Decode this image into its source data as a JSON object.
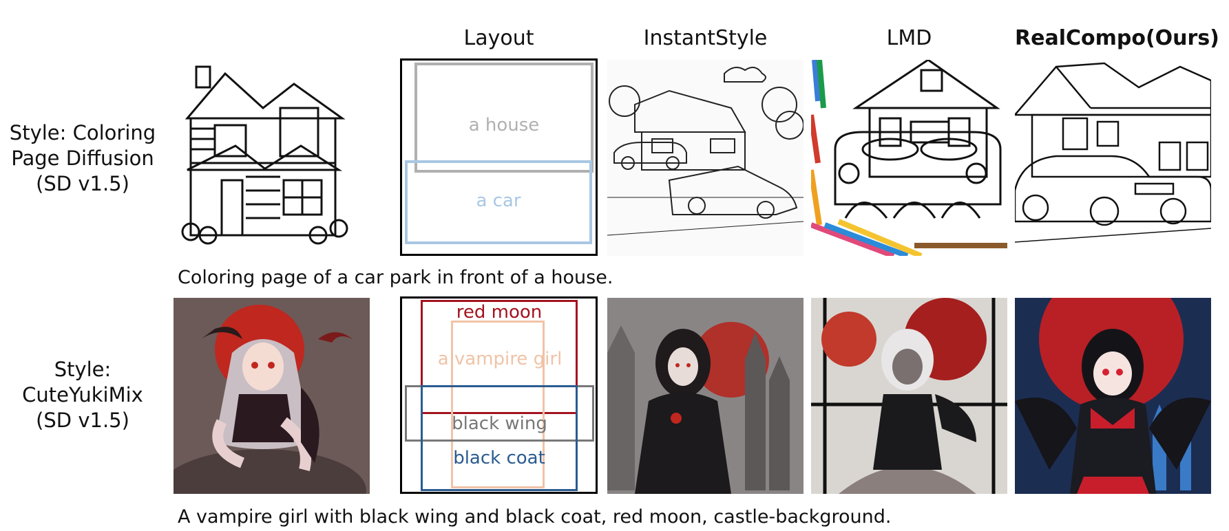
{
  "columns": {
    "layout": "Layout",
    "instantstyle": "InstantStyle",
    "lmd": "LMD",
    "realcompo": "RealCompo(Ours)"
  },
  "rows": [
    {
      "style_label": [
        "Style: Coloring",
        "Page Diffusion",
        "(SD v1.5)"
      ],
      "caption": "Coloring page of a car park in front of a house.",
      "layout_boxes": [
        {
          "label": "a house",
          "color": "#b0b0b0"
        },
        {
          "label": "a car",
          "color": "#a9c7e3"
        }
      ]
    },
    {
      "style_label": [
        "Style:",
        "CuteYukiMix",
        "(SD v1.5)"
      ],
      "caption": "A vampire girl with black wing and black coat, red moon, castle-background.",
      "layout_boxes": [
        {
          "label": "red moon",
          "color": "#a3121f"
        },
        {
          "label": "a vampire girl",
          "color": "#f0c3a6"
        },
        {
          "label": "black wing",
          "color": "#777777"
        },
        {
          "label": "black coat",
          "color": "#2a5b8f"
        }
      ]
    }
  ]
}
